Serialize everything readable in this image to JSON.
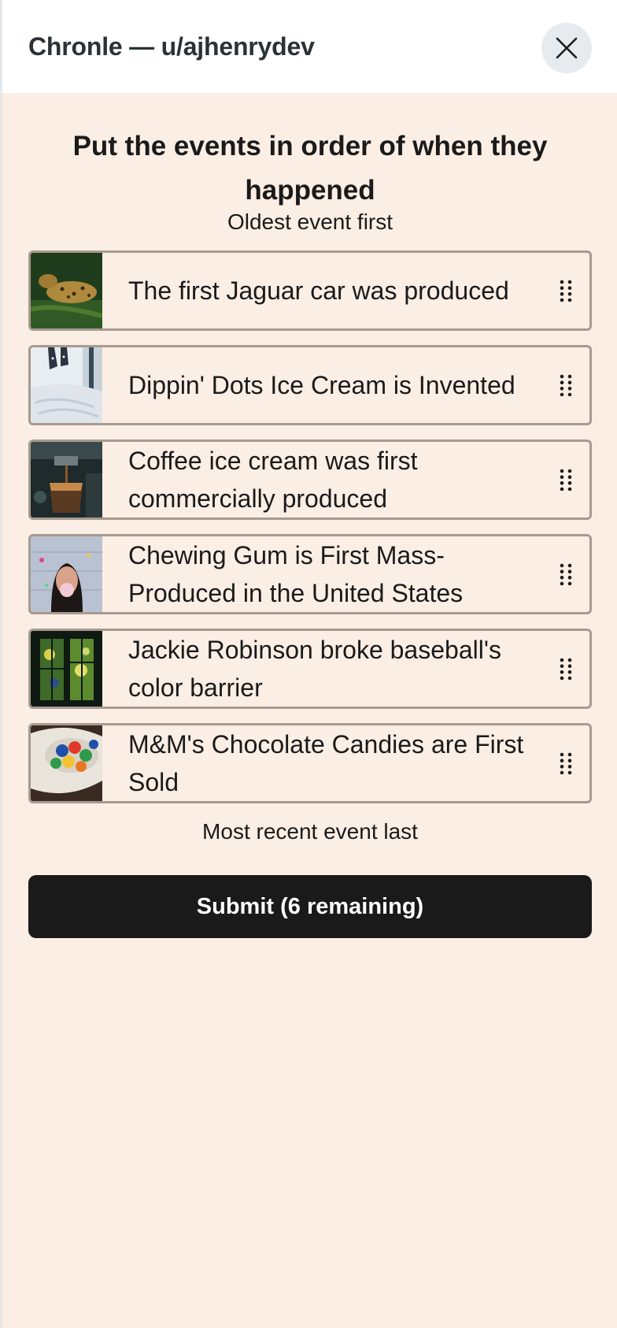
{
  "header": {
    "title": "Chronle — u/ajhenrydev",
    "close_icon": "close-icon"
  },
  "main": {
    "heading": "Put the events in order of when they happened",
    "top_hint": "Oldest event first",
    "bottom_hint": "Most recent event last",
    "submit_label": "Submit (6 remaining)",
    "events": [
      {
        "label": "The first Jaguar car was produced",
        "image": "jaguar-animal-photo"
      },
      {
        "label": "Dippin' Dots Ice Cream is Invented",
        "image": "feet-on-bed-photo"
      },
      {
        "label": "Coffee ice cream was first commercially produced",
        "image": "coffee-machine-photo"
      },
      {
        "label": "Chewing Gum is First Mass-Produced in the United States",
        "image": "bubble-gum-girl-photo"
      },
      {
        "label": "Jackie Robinson broke baseball's color barrier",
        "image": "stained-glass-window-photo"
      },
      {
        "label": "M&M's Chocolate Candies are First Sold",
        "image": "candy-bowl-photo"
      }
    ]
  },
  "colors": {
    "background": "#fbeee4",
    "card_border": "#a89a8f",
    "submit_bg": "#1a1a1a",
    "close_bg": "#e5ebee"
  }
}
